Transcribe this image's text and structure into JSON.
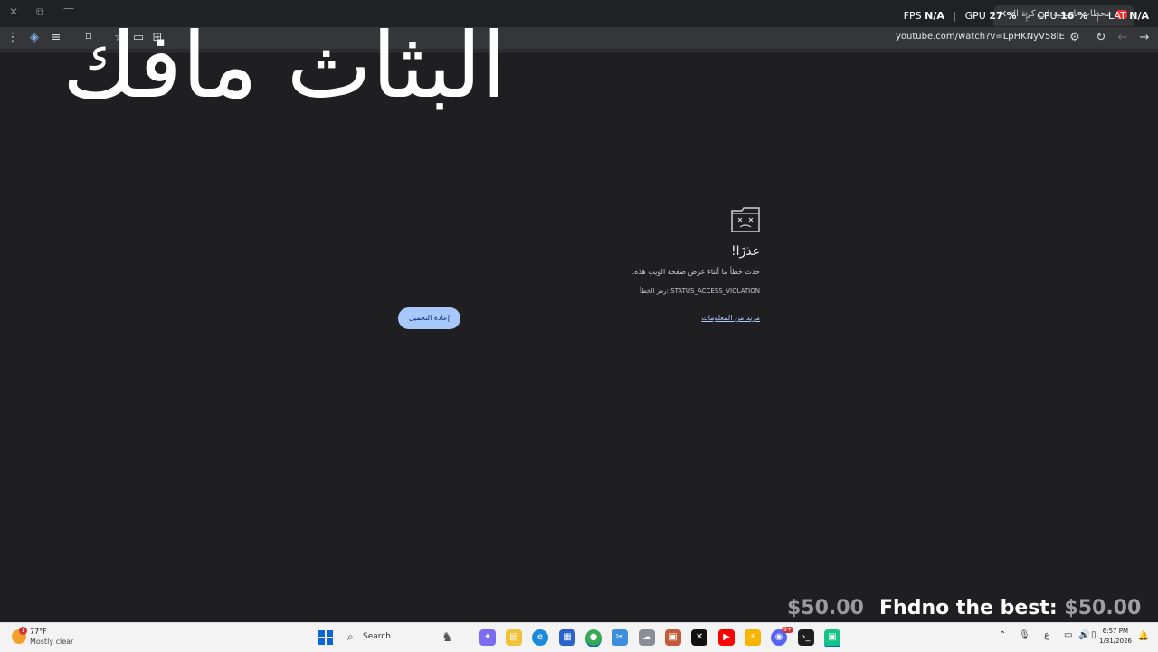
{
  "window": {
    "close_glyph": "✕",
    "restore_glyph": "⧉",
    "minimize_glyph": "—"
  },
  "tab": {
    "title": "محطات تاريخية في كرة القدم",
    "close_glyph": "✕"
  },
  "perf_overlay": {
    "fps_label": "FPS",
    "fps_value": "N/A",
    "gpu_label": "GPU",
    "gpu_value": "27 %",
    "cpu_label": "CPU",
    "cpu_value": "16 %",
    "lat_label": "LAT",
    "lat_value": "N/A"
  },
  "toolbar": {
    "url": "youtube.com/watch?v=LpHKNyV58lE",
    "icons": [
      "menu-icon",
      "extension-icon",
      "playlist-icon",
      "screenshot-icon",
      "star-icon",
      "cast-icon",
      "translate-icon",
      "site-settings-icon",
      "reload-icon",
      "back-icon",
      "forward-icon"
    ]
  },
  "overlay_title": "البثاث مافك",
  "crash": {
    "title": "عذرًا!",
    "description": "حدث خطأ ما أثناء عرض صفحة الويب هذه.",
    "error_code": "رمز الخطأ: STATUS_ACCESS_VIOLATION",
    "learn_more": "مزيد من المعلومات",
    "reload_button": "إعادة التحميل"
  },
  "donation": {
    "ghost_amount": "$50.00",
    "label": "Fhdno the best:",
    "amount": "$50.00"
  },
  "taskbar": {
    "weather_temp": "77°F",
    "weather_condition": "Mostly clear",
    "weather_badge": "1",
    "search_label": "Search",
    "apps": [
      "copilot-icon",
      "file-explorer-icon",
      "edge-icon",
      "store-icon",
      "chrome-icon",
      "snipping-tool-icon",
      "unknown-app-icon",
      "photos-icon",
      "capcut-icon",
      "youtube-icon",
      "app-icon",
      "discord-icon",
      "terminal-icon",
      "app-active-icon"
    ],
    "discord_badge": "9+",
    "ime_label": "ع",
    "clock_time": "6:57 PM",
    "clock_date": "1/31/2026"
  },
  "colors": {
    "page_bg": "#1f1f21",
    "link": "#a8c7fa",
    "button_bg": "#a8c7fa"
  }
}
